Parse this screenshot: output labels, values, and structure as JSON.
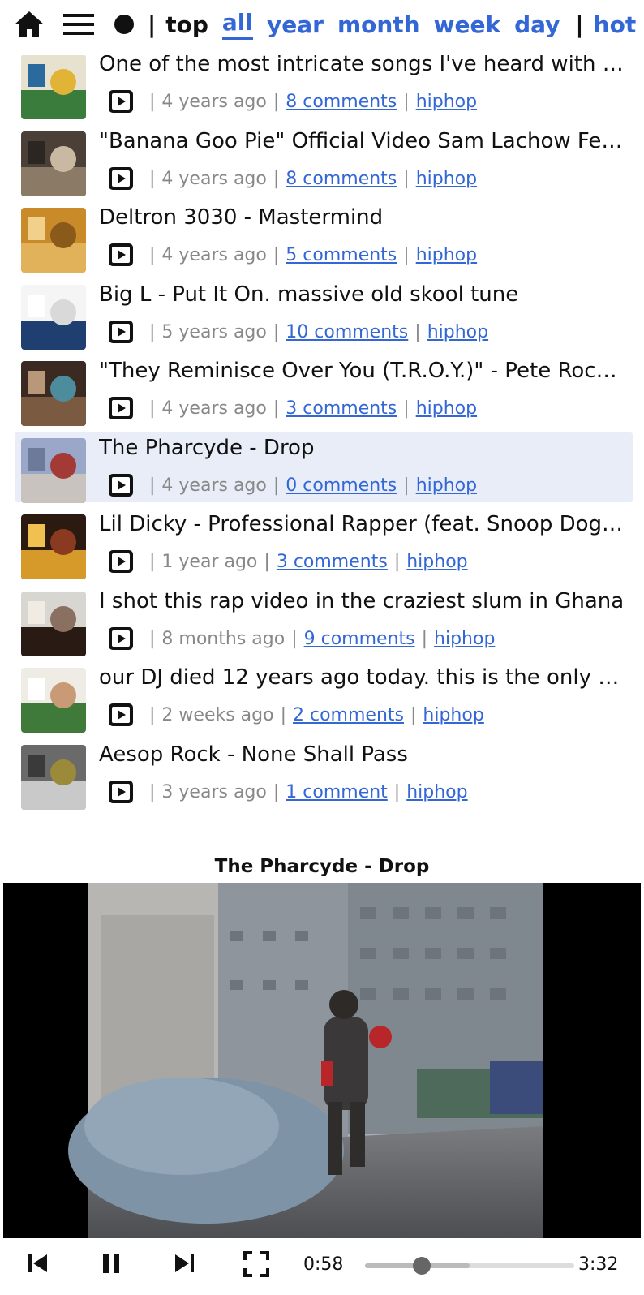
{
  "nav": {
    "separator": "|",
    "sort_label": "top",
    "tabs": [
      "all",
      "year",
      "month",
      "week",
      "day"
    ],
    "active_tab": "all",
    "tail_label": "hot"
  },
  "feed": {
    "items": [
      {
        "title": "One of the most intricate songs I've heard with …",
        "age": "4 years ago",
        "comments": "8 comments",
        "tag": "hiphop"
      },
      {
        "title": "\"Banana Goo Pie\" Official Video Sam Lachow Fe…",
        "age": "4 years ago",
        "comments": "8 comments",
        "tag": "hiphop"
      },
      {
        "title": "Deltron 3030 - Mastermind",
        "age": "4 years ago",
        "comments": "5 comments",
        "tag": "hiphop"
      },
      {
        "title": "Big L - Put It On. massive old skool tune",
        "age": "5 years ago",
        "comments": "10 comments",
        "tag": "hiphop"
      },
      {
        "title": "\"They Reminisce Over You (T.R.O.Y.)\" - Pete Roc…",
        "age": "4 years ago",
        "comments": "3 comments",
        "tag": "hiphop"
      },
      {
        "title": "The Pharcyde - Drop",
        "age": "4 years ago",
        "comments": "0 comments",
        "tag": "hiphop"
      },
      {
        "title": "Lil Dicky - Professional Rapper (feat. Snoop Dog…",
        "age": "1 year ago",
        "comments": "3 comments",
        "tag": "hiphop"
      },
      {
        "title": "I shot this rap video in the craziest slum in Ghana",
        "age": "8 months ago",
        "comments": "9 comments",
        "tag": "hiphop"
      },
      {
        "title": "our DJ died 12 years ago today. this is the only r…",
        "age": "2 weeks ago",
        "comments": "2 comments",
        "tag": "hiphop"
      },
      {
        "title": "Aesop Rock - None Shall Pass",
        "age": "3 years ago",
        "comments": "1 comment",
        "tag": "hiphop"
      }
    ],
    "selected_index": 5,
    "meta_separator": "|"
  },
  "player": {
    "title": "The Pharcyde - Drop",
    "current_time": "0:58",
    "duration": "3:32",
    "progress": 0.273,
    "buffered": 0.5
  },
  "colors": {
    "link": "#3367d6",
    "selected_row": "#e8edf8",
    "muted": "#888888"
  },
  "icons": {
    "home": "home-icon",
    "menu": "hamburger-menu-icon",
    "dot": "circle-icon",
    "video": "play-box-icon",
    "prev": "skip-previous-icon",
    "pause": "pause-icon",
    "next": "skip-next-icon",
    "fullscreen": "fullscreen-icon"
  }
}
